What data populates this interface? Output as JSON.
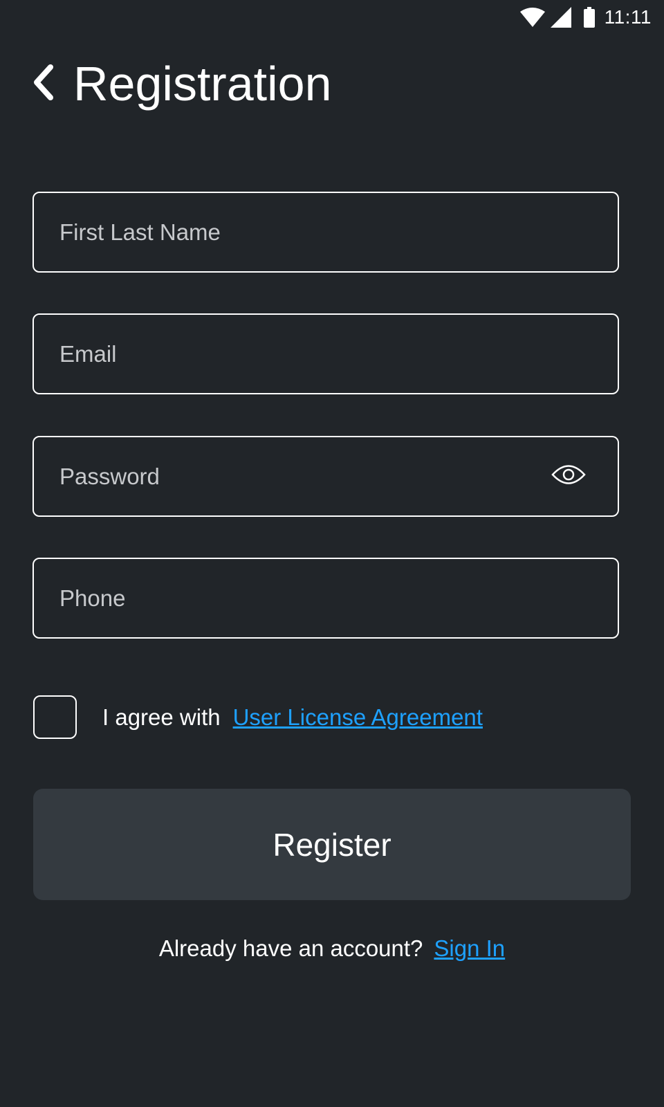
{
  "status_bar": {
    "time": "11:11",
    "icons": [
      "wifi-icon",
      "cell-signal-icon",
      "battery-icon"
    ]
  },
  "header": {
    "title": "Registration",
    "back_icon": "chevron-left-icon"
  },
  "form": {
    "name_placeholder": "First Last Name",
    "name_value": "",
    "email_placeholder": "Email",
    "email_value": "",
    "password_placeholder": "Password",
    "password_value": "",
    "password_toggle_icon": "eye-icon",
    "phone_placeholder": "Phone",
    "phone_value": ""
  },
  "agreement": {
    "checked": false,
    "text": "I agree with",
    "link_label": "User License Agreement"
  },
  "register_button_label": "Register",
  "signin": {
    "prompt": "Already have an account?",
    "link_label": "Sign In"
  },
  "colors": {
    "background": "#212529",
    "button_background": "#343a40",
    "link": "#1ea1ff",
    "text": "#ffffff",
    "placeholder": "#c7c9cc"
  }
}
